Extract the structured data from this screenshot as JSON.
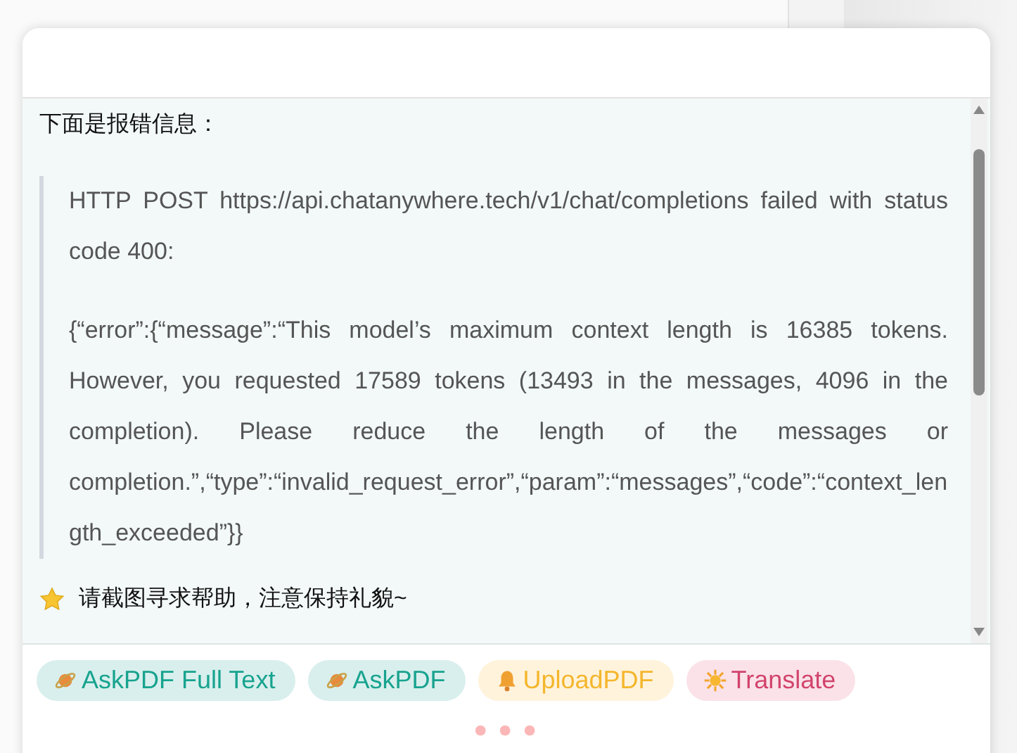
{
  "message": {
    "intro": "下面是报错信息：",
    "quote": [
      "HTTP POST https://api.chatanywhere.tech/v1/chat/completions failed with status code 400:",
      "{“error”:{“message”:“This model’s maximum context length is 16385 tokens. However, you requested 17589 tokens (13493 in the messages, 4096 in the completion). Please reduce the length of the messages or completion.”,“type”:“invalid_request_error”,“param”:“messages”,“code”:“context_length_exceeded”}}"
    ],
    "tip": "请截图寻求帮助，注意保持礼貌~"
  },
  "actions": [
    {
      "label": "AskPDF Full Text",
      "kind": "planet",
      "color": "#17a38f"
    },
    {
      "label": "AskPDF",
      "kind": "planet",
      "color": "#17a38f"
    },
    {
      "label": "UploadPDF",
      "kind": "bell",
      "color": "#f4b62c"
    },
    {
      "label": "Translate",
      "kind": "sun",
      "color": "#d2436c"
    }
  ]
}
